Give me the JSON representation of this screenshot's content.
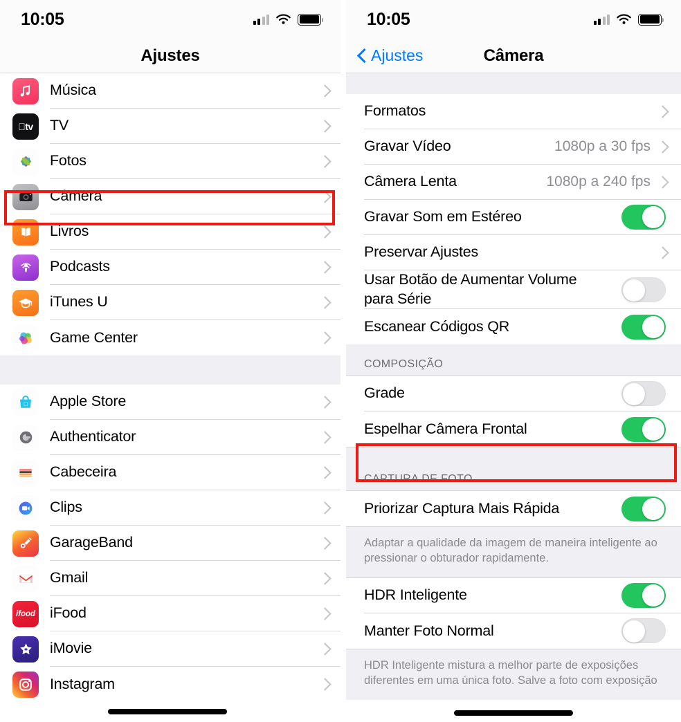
{
  "left": {
    "status": {
      "time": "10:05",
      "signal_icon": "cellular-bars-icon",
      "wifi_icon": "wifi-icon",
      "battery_icon": "battery-full-icon"
    },
    "nav": {
      "title": "Ajustes"
    },
    "section1": [
      {
        "label": "Música",
        "icon": "music-app-icon",
        "accessory": "chevron"
      },
      {
        "label": "TV",
        "icon": "appletv-app-icon",
        "accessory": "chevron"
      },
      {
        "label": "Fotos",
        "icon": "photos-app-icon",
        "accessory": "chevron"
      },
      {
        "label": "Câmera",
        "icon": "camera-app-icon",
        "accessory": "chevron"
      },
      {
        "label": "Livros",
        "icon": "books-app-icon",
        "accessory": "chevron"
      },
      {
        "label": "Podcasts",
        "icon": "podcasts-app-icon",
        "accessory": "chevron"
      },
      {
        "label": "iTunes U",
        "icon": "itunesu-app-icon",
        "accessory": "chevron"
      },
      {
        "label": "Game Center",
        "icon": "gamecenter-app-icon",
        "accessory": "chevron"
      }
    ],
    "section2": [
      {
        "label": "Apple Store",
        "icon": "applestore-app-icon",
        "accessory": "chevron"
      },
      {
        "label": "Authenticator",
        "icon": "authenticator-app-icon",
        "accessory": "chevron"
      },
      {
        "label": "Cabeceira",
        "icon": "cabeceira-app-icon",
        "accessory": "chevron"
      },
      {
        "label": "Clips",
        "icon": "clips-app-icon",
        "accessory": "chevron"
      },
      {
        "label": "GarageBand",
        "icon": "garageband-app-icon",
        "accessory": "chevron"
      },
      {
        "label": "Gmail",
        "icon": "gmail-app-icon",
        "accessory": "chevron"
      },
      {
        "label": "iFood",
        "icon": "ifood-app-icon",
        "accessory": "chevron"
      },
      {
        "label": "iMovie",
        "icon": "imovie-app-icon",
        "accessory": "chevron"
      },
      {
        "label": "Instagram",
        "icon": "instagram-app-icon",
        "accessory": "chevron"
      }
    ],
    "highlight": {
      "target": "Câmera",
      "color": "#ee1b12"
    }
  },
  "right": {
    "status": {
      "time": "10:05",
      "signal_icon": "cellular-bars-icon",
      "wifi_icon": "wifi-icon",
      "battery_icon": "battery-full-icon"
    },
    "nav": {
      "back_label": "Ajustes",
      "back_icon": "chevron-left-icon",
      "title": "Câmera"
    },
    "group1": [
      {
        "label": "Formatos",
        "value": "",
        "accessory": "chevron"
      },
      {
        "label": "Gravar Vídeo",
        "value": "1080p a 30 fps",
        "accessory": "chevron"
      },
      {
        "label": "Câmera Lenta",
        "value": "1080p a 240 fps",
        "accessory": "chevron"
      },
      {
        "label": "Gravar Som em Estéreo",
        "value": "",
        "accessory": "toggle",
        "toggle": "on"
      },
      {
        "label": "Preservar Ajustes",
        "value": "",
        "accessory": "chevron"
      },
      {
        "label": "Usar Botão de Aumentar Volume para Série",
        "value": "",
        "accessory": "toggle",
        "toggle": "off"
      },
      {
        "label": "Escanear Códigos QR",
        "value": "",
        "accessory": "toggle",
        "toggle": "on"
      }
    ],
    "section_composicao": {
      "header": "COMPOSIÇÃO",
      "rows": [
        {
          "label": "Grade",
          "accessory": "toggle",
          "toggle": "off"
        },
        {
          "label": "Espelhar Câmera Frontal",
          "accessory": "toggle",
          "toggle": "on"
        }
      ]
    },
    "section_captura": {
      "header": "CAPTURA DE FOTO",
      "rows": [
        {
          "label": "Priorizar Captura Mais Rápida",
          "accessory": "toggle",
          "toggle": "on"
        }
      ],
      "footnote": "Adaptar a qualidade da imagem de maneira inteligente ao pressionar o obturador rapidamente."
    },
    "section_hdr": {
      "rows": [
        {
          "label": "HDR Inteligente",
          "accessory": "toggle",
          "toggle": "on"
        },
        {
          "label": "Manter Foto Normal",
          "accessory": "toggle",
          "toggle": "off"
        }
      ],
      "footnote": "HDR Inteligente mistura a melhor parte de exposições diferentes em uma única foto. Salve a foto com exposição"
    },
    "highlight": {
      "target": "Espelhar Câmera Frontal",
      "color": "#ee1b12"
    }
  },
  "colors": {
    "accent_blue": "#007aff",
    "toggle_on": "#22c55e",
    "toggle_off": "#e4e4e6",
    "highlight_red": "#ee1b12",
    "group_bg": "#efeff4",
    "separator": "#d6d6d8",
    "value_gray": "#8e8e93",
    "footnote_gray": "#8a8a8e"
  }
}
